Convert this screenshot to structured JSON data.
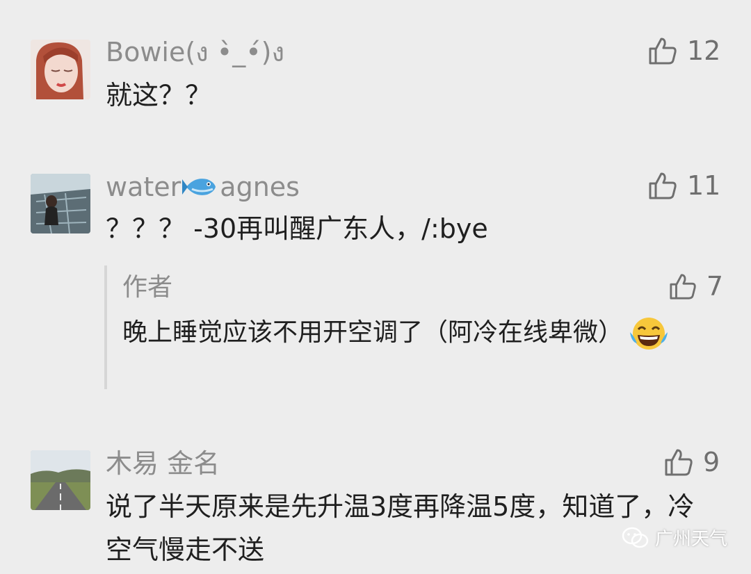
{
  "comments": [
    {
      "name": "Bowie(ง •̀_•́)ง",
      "text": "就这？？",
      "likes": "12"
    },
    {
      "name_prefix": "water",
      "name_suffix": "agnes",
      "name_emoji": "fish-icon",
      "text": "？？？ -30再叫醒广东人，/:bye",
      "likes": "11",
      "reply": {
        "author": "作者",
        "text": "晚上睡觉应该不用开空调了（阿冷在线卑微）",
        "emoji": "tears-of-joy-emoji",
        "likes": "7"
      }
    },
    {
      "name": "木易 金名",
      "text": "说了半天原来是先升温3度再降温5度，知道了，冷空气慢走不送",
      "likes": "9"
    }
  ],
  "watermark": {
    "text": "广州天气",
    "icon": "wechat-icon"
  },
  "colors": {
    "background": "#ededed",
    "name": "#8c8c8c",
    "text": "#1f1f1f",
    "like": "#6f6f6f"
  }
}
